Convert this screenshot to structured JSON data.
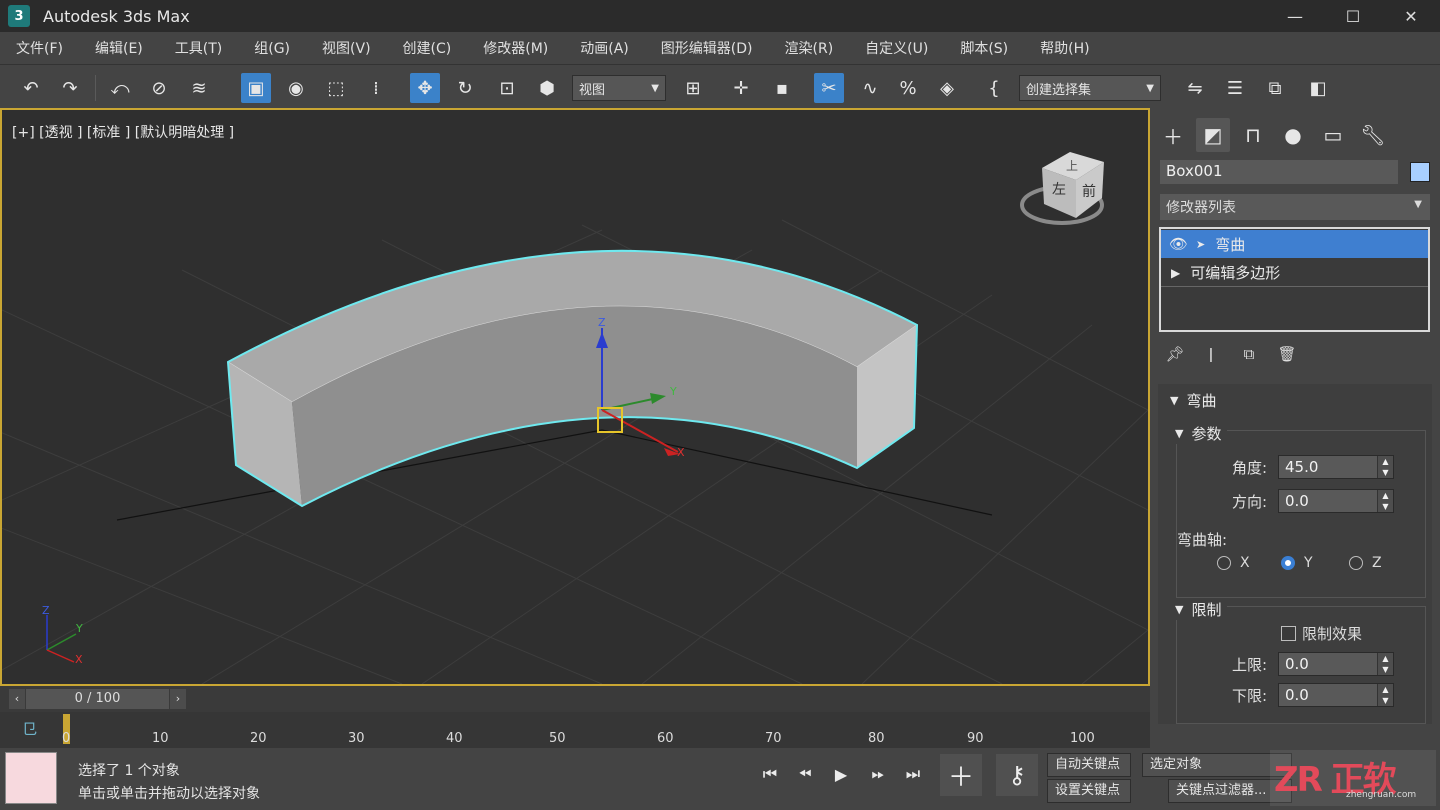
{
  "window": {
    "title": "Autodesk 3ds Max",
    "logo": "3",
    "minimize": "—",
    "maximize": "☐",
    "close": "✕"
  },
  "menu": [
    "文件(F)",
    "编辑(E)",
    "工具(T)",
    "组(G)",
    "视图(V)",
    "创建(C)",
    "修改器(M)",
    "动画(A)",
    "图形编辑器(D)",
    "渲染(R)",
    "自定义(U)",
    "脚本(S)",
    "帮助(H)"
  ],
  "toolbar": {
    "view_dropdown": "视图",
    "selection_set_dropdown": "创建选择集"
  },
  "viewport": {
    "label": "[+] [透视 ] [标准 ] [默认明暗处理 ]",
    "viewcube": {
      "top": "上",
      "left": "左",
      "front": "前"
    },
    "gizmo": {
      "x": "X",
      "y": "Y",
      "z": "Z"
    }
  },
  "panel": {
    "object_name": "Box001",
    "object_color": "#a8cfff",
    "modifier_list": "修改器列表",
    "stack": [
      {
        "label": "弯曲",
        "selected": true
      },
      {
        "label": "可编辑多边形",
        "selected": false
      }
    ],
    "rollout_title": "弯曲",
    "params_title": "参数",
    "angle_label": "角度:",
    "angle_value": "45.0",
    "direction_label": "方向:",
    "direction_value": "0.0",
    "axis_label": "弯曲轴:",
    "axis_options": [
      "X",
      "Y",
      "Z"
    ],
    "axis_selected": "Y",
    "limits_title": "限制",
    "limit_effect_label": "限制效果",
    "upper_label": "上限:",
    "upper_value": "0.0",
    "lower_label": "下限:",
    "lower_value": "0.0"
  },
  "timeline": {
    "frame": "0 / 100",
    "ticks": [
      "0",
      "10",
      "20",
      "30",
      "40",
      "50",
      "60",
      "70",
      "80",
      "90",
      "100"
    ]
  },
  "status": {
    "line1": "选择了 1 个对象",
    "line2": "单击或单击并拖动以选择对象",
    "auto_key": "自动关键点",
    "set_key": "设置关键点",
    "selected_object": "选定对象",
    "key_filter": "关键点过滤器...",
    "watermark": "ZR 正软",
    "watermark_url": "zhengruan.com"
  }
}
